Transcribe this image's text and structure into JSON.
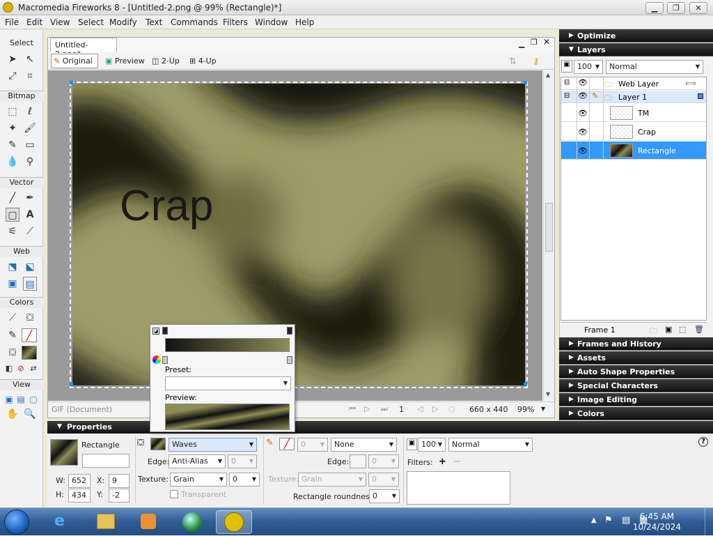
{
  "window": {
    "title": "Macromedia Fireworks 8 - [Untitled-2.png @ 99% (Rectangle)*]",
    "minimize": "▁",
    "restore": "❐",
    "close": "✕"
  },
  "menu": [
    "File",
    "Edit",
    "View",
    "Select",
    "Modify",
    "Text",
    "Commands",
    "Filters",
    "Window",
    "Help"
  ],
  "tools": {
    "sections": [
      "Select",
      "Bitmap",
      "Vector",
      "Web",
      "Colors",
      "View"
    ]
  },
  "document": {
    "tab_label": "Untitled-2.png*",
    "views": [
      "Original",
      "Preview",
      "2-Up",
      "4-Up"
    ],
    "canvas_text": "Crap",
    "status_left": "GIF (Document)",
    "frame_number": "1",
    "size": "660 x 440",
    "zoom": "99%"
  },
  "panels": {
    "optimize": "Optimize",
    "layers": "Layers",
    "opacity": "100",
    "blend": "Normal",
    "layer_rows": [
      {
        "name": "Web Layer",
        "type": "folder"
      },
      {
        "name": "Layer 1",
        "type": "folder"
      },
      {
        "name": "TM",
        "type": "object"
      },
      {
        "name": "Crap",
        "type": "object"
      },
      {
        "name": "Rectangle",
        "type": "object"
      }
    ],
    "frame_label": "Frame 1",
    "collapsed": [
      "Frames and History",
      "Assets",
      "Auto Shape Properties",
      "Special Characters",
      "Image Editing",
      "Colors"
    ]
  },
  "properties": {
    "title": "Properties",
    "object_name": "Rectangle",
    "w_label": "W:",
    "w": "652",
    "h_label": "H:",
    "h": "434",
    "x_label": "X:",
    "x": "9",
    "y_label": "Y:",
    "y": "-2",
    "fill_type": "Waves",
    "edge_label": "Edge:",
    "edge": "Anti-Alias",
    "edge_val": "0",
    "texture_label": "Texture:",
    "texture": "Grain",
    "texture_val": "0",
    "transparent_label": "Transparent",
    "stroke_size": "0",
    "stroke_type": "None",
    "stroke_edge_label": "Edge:",
    "stroke_edge_val": "0",
    "stroke_texture_label": "Texture:",
    "stroke_texture": "Grain",
    "stroke_texture_val": "0",
    "roundness_label": "Rectangle roundness:",
    "roundness": "0",
    "opacity": "100",
    "blend": "Normal",
    "filters_label": "Filters:",
    "help": "?"
  },
  "gradient_popup": {
    "preset_label": "Preset:",
    "preview_label": "Preview:"
  },
  "taskbar": {
    "time": "6:45 AM",
    "date": "10/24/2024"
  },
  "colors": {
    "canvas_bg": "#8e8c55",
    "selection_blue": "#3399ff",
    "panel_header": "#111111"
  }
}
